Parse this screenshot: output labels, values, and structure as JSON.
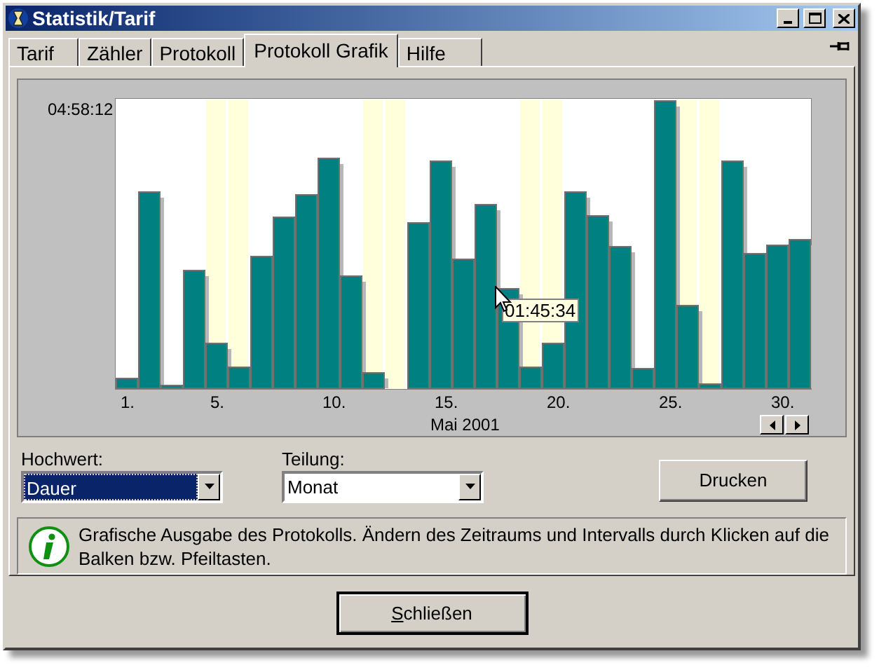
{
  "window": {
    "title": "Statistik/Tarif"
  },
  "tabs": [
    {
      "label": "Tarif",
      "selected": false
    },
    {
      "label": "Zähler",
      "selected": false
    },
    {
      "label": "Protokoll",
      "selected": false
    },
    {
      "label": "Protokoll Grafik",
      "selected": true
    },
    {
      "label": "Hilfe",
      "selected": false
    }
  ],
  "chart": {
    "y_max_label": "04:58:12",
    "x_labels": [
      "1.",
      "5.",
      "10.",
      "15.",
      "20.",
      "25.",
      "30."
    ],
    "xlabel": "Mai 2001",
    "tooltip": "01:45:34"
  },
  "fields": [
    {
      "label": "Hochwert:",
      "value": "Dauer",
      "focused": true
    },
    {
      "label": "Teilung:",
      "value": "Monat",
      "focused": false
    }
  ],
  "print_button": "Drucken",
  "info": "Grafische Ausgabe des Protokolls. Ändern des Zeitraums und Intervalls durch Klicken auf die Balken bzw. Pfeiltasten.",
  "close_button": "Schließen"
}
